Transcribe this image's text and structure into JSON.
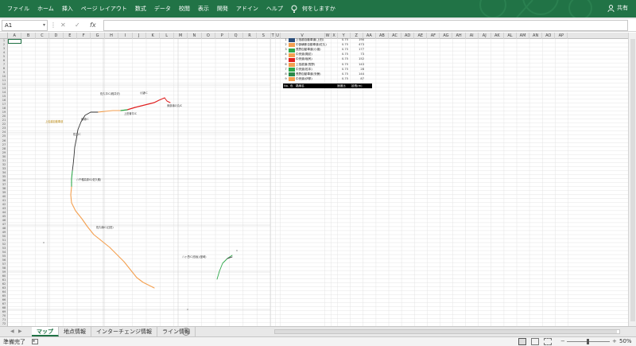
{
  "colors": {
    "excel_green": "#217346",
    "route_orange": "#f4a050",
    "route_red": "#e02020",
    "route_green": "#2da84a",
    "route_dark": "#333333"
  },
  "ribbon": {
    "tabs": [
      "ファイル",
      "ホーム",
      "挿入",
      "ページ レイアウト",
      "数式",
      "データ",
      "校閲",
      "表示",
      "開発",
      "アドイン",
      "ヘルプ"
    ],
    "tell_me": "何をしますか",
    "share": "共有"
  },
  "formula_bar": {
    "name_box": "A1",
    "cancel": "✕",
    "enter": "✓",
    "fx": "fx",
    "value": ""
  },
  "columns": [
    "A",
    "B",
    "C",
    "D",
    "E",
    "F",
    "G",
    "H",
    "I",
    "J",
    "K",
    "L",
    "M",
    "N",
    "O",
    "P",
    "Q",
    "R",
    "S",
    "T",
    "U",
    "V",
    "W",
    "X",
    "Y",
    "Z",
    "AA",
    "AB",
    "AC",
    "AD",
    "AE",
    "AF",
    "AG",
    "AH",
    "AI",
    "AJ",
    "AK",
    "AL",
    "AM",
    "AN",
    "AO",
    "AP"
  ],
  "legend": {
    "rows": [
      {
        "no": "1",
        "color": "#2a4d7a",
        "name": "上信越自動車道(上田)",
        "speed": "0.75",
        "length": "190"
      },
      {
        "no": "2",
        "color": "#f4a050",
        "name": "中部横断自動車道(佐久)",
        "speed": "0.75",
        "length": "473"
      },
      {
        "no": "3",
        "color": "#2da84a",
        "name": "長野自動車道(小諸)",
        "speed": "0.75",
        "length": "177"
      },
      {
        "no": "4",
        "color": "#f4a050",
        "name": "中央道(諏訪)",
        "speed": "0.75",
        "length": "73"
      },
      {
        "no": "5",
        "color": "#e02020",
        "name": "中央道(塩尻)",
        "speed": "0.75",
        "length": "152"
      },
      {
        "no": "6",
        "color": "#f4a050",
        "name": "上信越道(長野)",
        "speed": "0.75",
        "length": "143"
      },
      {
        "no": "7",
        "color": "#2da84a",
        "name": "中央道(松本)",
        "speed": "0.75",
        "length": "28"
      },
      {
        "no": "8",
        "color": "#2a8a4a",
        "name": "長野自動車道(安曇)",
        "speed": "0.75",
        "length": "144"
      },
      {
        "no": "9",
        "color": "#f4a050",
        "name": "中央道(伊那)",
        "speed": "0.75",
        "length": "87"
      }
    ],
    "header": {
      "no": "No.",
      "color": "色",
      "name": "路線名",
      "speed": "速度比",
      "length": "延長(m)"
    }
  },
  "map_labels": [
    {
      "text": "佐久平IC(軽井沢)"
    },
    {
      "text": "小諸IC"
    },
    {
      "text": "東部湯の丸IC"
    },
    {
      "text": "上田菅平IC"
    },
    {
      "text": "坂城IC"
    },
    {
      "text": "上信越自動車道"
    },
    {
      "text": "佐久IC"
    },
    {
      "text": "八千穂高原IC(佐久穂)"
    },
    {
      "text": "佐久南IC(臼田)"
    },
    {
      "text": "八ヶ岳IC(長坂)(韮崎)"
    },
    {
      "text": "長坂IC(韮崎)(北杜)"
    }
  ],
  "sheets": [
    {
      "label": "マップ",
      "active": true
    },
    {
      "label": "地点情報",
      "active": false
    },
    {
      "label": "インターチェンジ情報",
      "active": false
    },
    {
      "label": "ライン情報",
      "active": false
    }
  ],
  "status": {
    "ready": "準備完了",
    "zoom_minus": "−",
    "zoom_plus": "+",
    "zoom": "50%",
    "zoom_level": 50
  }
}
